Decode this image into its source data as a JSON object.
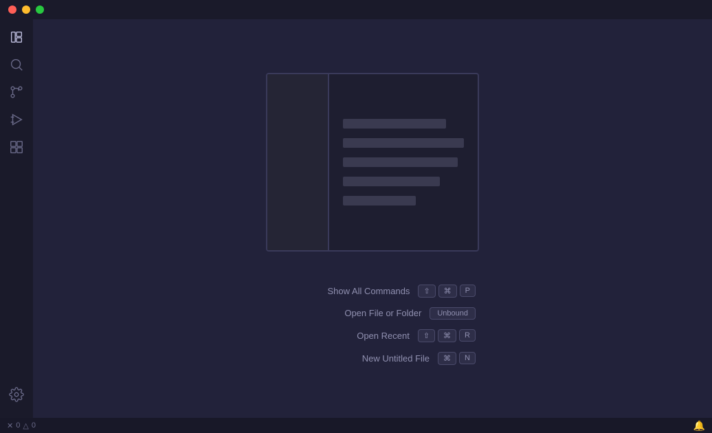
{
  "titlebar": {
    "title": ""
  },
  "activity_bar": {
    "icons": [
      {
        "name": "files-icon",
        "label": "Explorer",
        "active": true
      },
      {
        "name": "search-icon",
        "label": "Search",
        "active": false
      },
      {
        "name": "source-control-icon",
        "label": "Source Control",
        "active": false
      },
      {
        "name": "run-debug-icon",
        "label": "Run and Debug",
        "active": false
      },
      {
        "name": "extensions-icon",
        "label": "Extensions",
        "active": false
      }
    ],
    "bottom_icons": [
      {
        "name": "settings-icon",
        "label": "Settings",
        "active": false
      }
    ]
  },
  "shortcuts": [
    {
      "label": "Show All Commands",
      "keys": [
        "⇧",
        "⌘",
        "P"
      ]
    },
    {
      "label": "Open File or Folder",
      "keys": [
        "Unbound"
      ]
    },
    {
      "label": "Open Recent",
      "keys": [
        "⇧",
        "⌘",
        "R"
      ]
    },
    {
      "label": "New Untitled File",
      "keys": [
        "⌘",
        "N"
      ]
    }
  ],
  "status_bar": {
    "errors": "0",
    "warnings": "0",
    "error_icon": "✕",
    "warning_icon": "△"
  }
}
